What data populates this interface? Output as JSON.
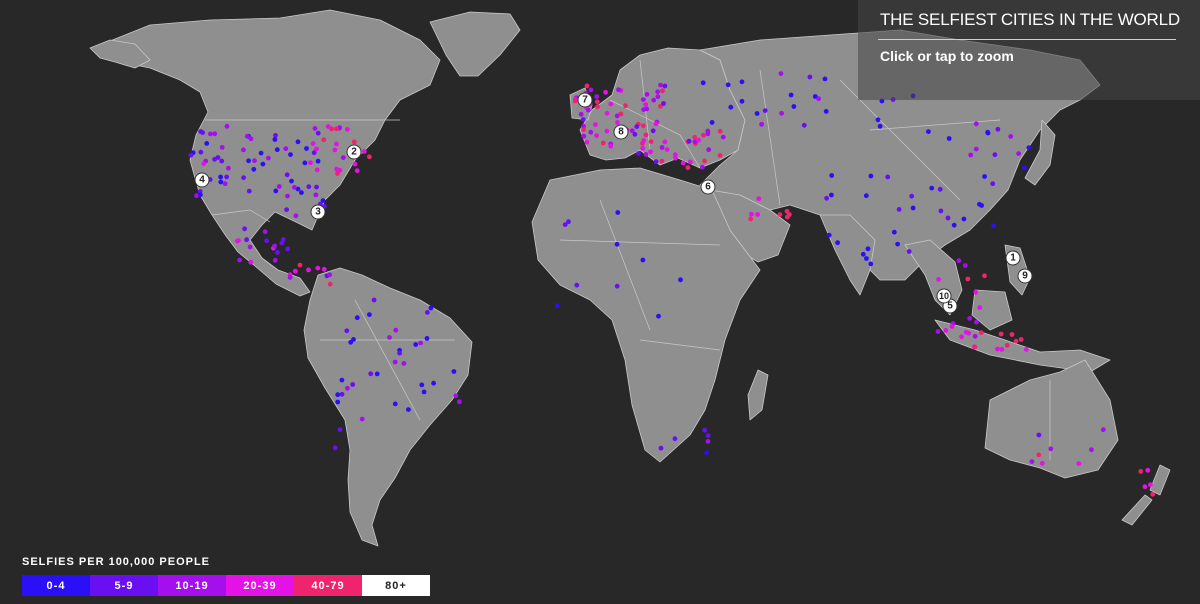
{
  "header": {
    "title": "THE SELFIEST CITIES IN THE WORLD",
    "zoom_hint": "Click or tap to zoom"
  },
  "legend": {
    "title": "SELFIES PER 100,000 PEOPLE",
    "bins": [
      {
        "label": "0-4",
        "color": "#2b10f5",
        "text_color": "#ffffff"
      },
      {
        "label": "5-9",
        "color": "#6a0ff2",
        "text_color": "#ffffff"
      },
      {
        "label": "10-19",
        "color": "#a50fee",
        "text_color": "#ffffff"
      },
      {
        "label": "20-39",
        "color": "#e512e6",
        "text_color": "#ffffff"
      },
      {
        "label": "40-79",
        "color": "#f0246e",
        "text_color": "#ffffff"
      },
      {
        "label": "80+",
        "color": "#ffffff",
        "text_color": "#222222"
      }
    ]
  },
  "ranked_markers": [
    "1",
    "2",
    "3",
    "4",
    "5",
    "6",
    "7",
    "8",
    "9",
    "10"
  ],
  "colors": {
    "background": "#282828",
    "land": "#8f8f8f",
    "borders": "#c9c9c9"
  }
}
